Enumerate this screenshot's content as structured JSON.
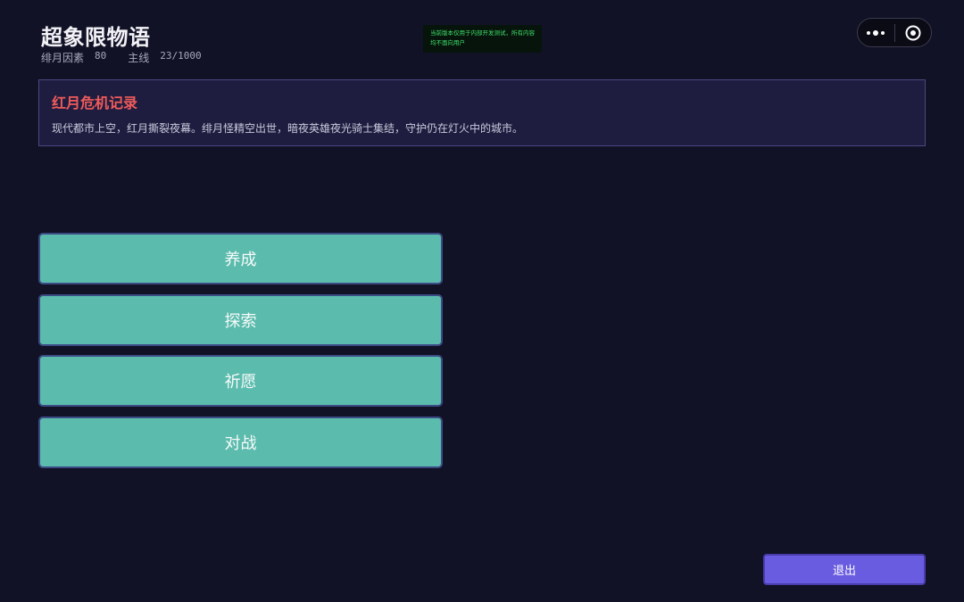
{
  "header": {
    "title": "超象限物语",
    "stats": [
      {
        "label": "绯月因素",
        "value": "80"
      },
      {
        "label": "主线",
        "value": "23/1000"
      }
    ]
  },
  "notice": {
    "text": "当前版本仅用于内部开发测试，所有内容均不面向用户"
  },
  "capsule": {
    "more_icon": "more-dots-icon",
    "close_icon": "target-close-icon"
  },
  "panel": {
    "title": "红月危机记录",
    "text": "现代都市上空，红月撕裂夜幕。绯月怪精空出世，暗夜英雄夜光骑士集结，守护仍在灯火中的城市。"
  },
  "menu": {
    "items": [
      {
        "label": "养成"
      },
      {
        "label": "探索"
      },
      {
        "label": "祈愿"
      },
      {
        "label": "对战"
      }
    ]
  },
  "footer": {
    "exit_label": "退出"
  },
  "colors": {
    "background": "#121227",
    "menu_button": "#5bbbad",
    "exit_button": "#6a5ce0",
    "panel_title": "#ef5b5b",
    "notice_text": "#3fe06a"
  }
}
